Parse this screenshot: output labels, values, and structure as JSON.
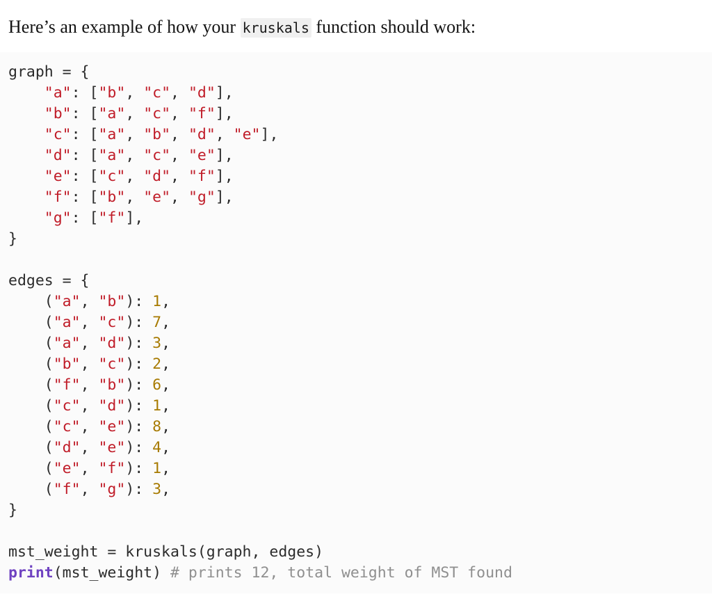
{
  "intro": {
    "before": "Here’s an example of how your ",
    "code": "kruskals",
    "after": " function should work:"
  },
  "code": {
    "language": "python",
    "graph_header": "graph = {",
    "graph_entries": [
      {
        "key": "\"a\"",
        "value": "[\"b\", \"c\", \"d\"]"
      },
      {
        "key": "\"b\"",
        "value": "[\"a\", \"c\", \"f\"]"
      },
      {
        "key": "\"c\"",
        "value": "[\"a\", \"b\", \"d\", \"e\"]"
      },
      {
        "key": "\"d\"",
        "value": "[\"a\", \"c\", \"e\"]"
      },
      {
        "key": "\"e\"",
        "value": "[\"c\", \"d\", \"f\"]"
      },
      {
        "key": "\"f\"",
        "value": "[\"b\", \"e\", \"g\"]"
      },
      {
        "key": "\"g\"",
        "value": "[\"f\"]"
      }
    ],
    "graph_close": "}",
    "edges_header": "edges = {",
    "edges_entries": [
      {
        "u": "\"a\"",
        "v": "\"b\"",
        "w": "1"
      },
      {
        "u": "\"a\"",
        "v": "\"c\"",
        "w": "7"
      },
      {
        "u": "\"a\"",
        "v": "\"d\"",
        "w": "3"
      },
      {
        "u": "\"b\"",
        "v": "\"c\"",
        "w": "2"
      },
      {
        "u": "\"f\"",
        "v": "\"b\"",
        "w": "6"
      },
      {
        "u": "\"c\"",
        "v": "\"d\"",
        "w": "1"
      },
      {
        "u": "\"c\"",
        "v": "\"e\"",
        "w": "8"
      },
      {
        "u": "\"d\"",
        "v": "\"e\"",
        "w": "4"
      },
      {
        "u": "\"e\"",
        "v": "\"f\"",
        "w": "1"
      },
      {
        "u": "\"f\"",
        "v": "\"g\"",
        "w": "3"
      }
    ],
    "edges_close": "}",
    "call_line": "mst_weight = kruskals(graph, edges)",
    "print_builtin": "print",
    "print_args": "(mst_weight)",
    "print_comment": "# prints 12, total weight of MST found"
  },
  "colors": {
    "string": "#c01c28",
    "number": "#a77a00",
    "builtin": "#6f42c1",
    "comment": "#8f8f8f",
    "plain": "#2b2b2b",
    "code_background": "#fbfbfb",
    "inline_code_background": "#f0f0f0",
    "page_background": "#ffffff"
  }
}
